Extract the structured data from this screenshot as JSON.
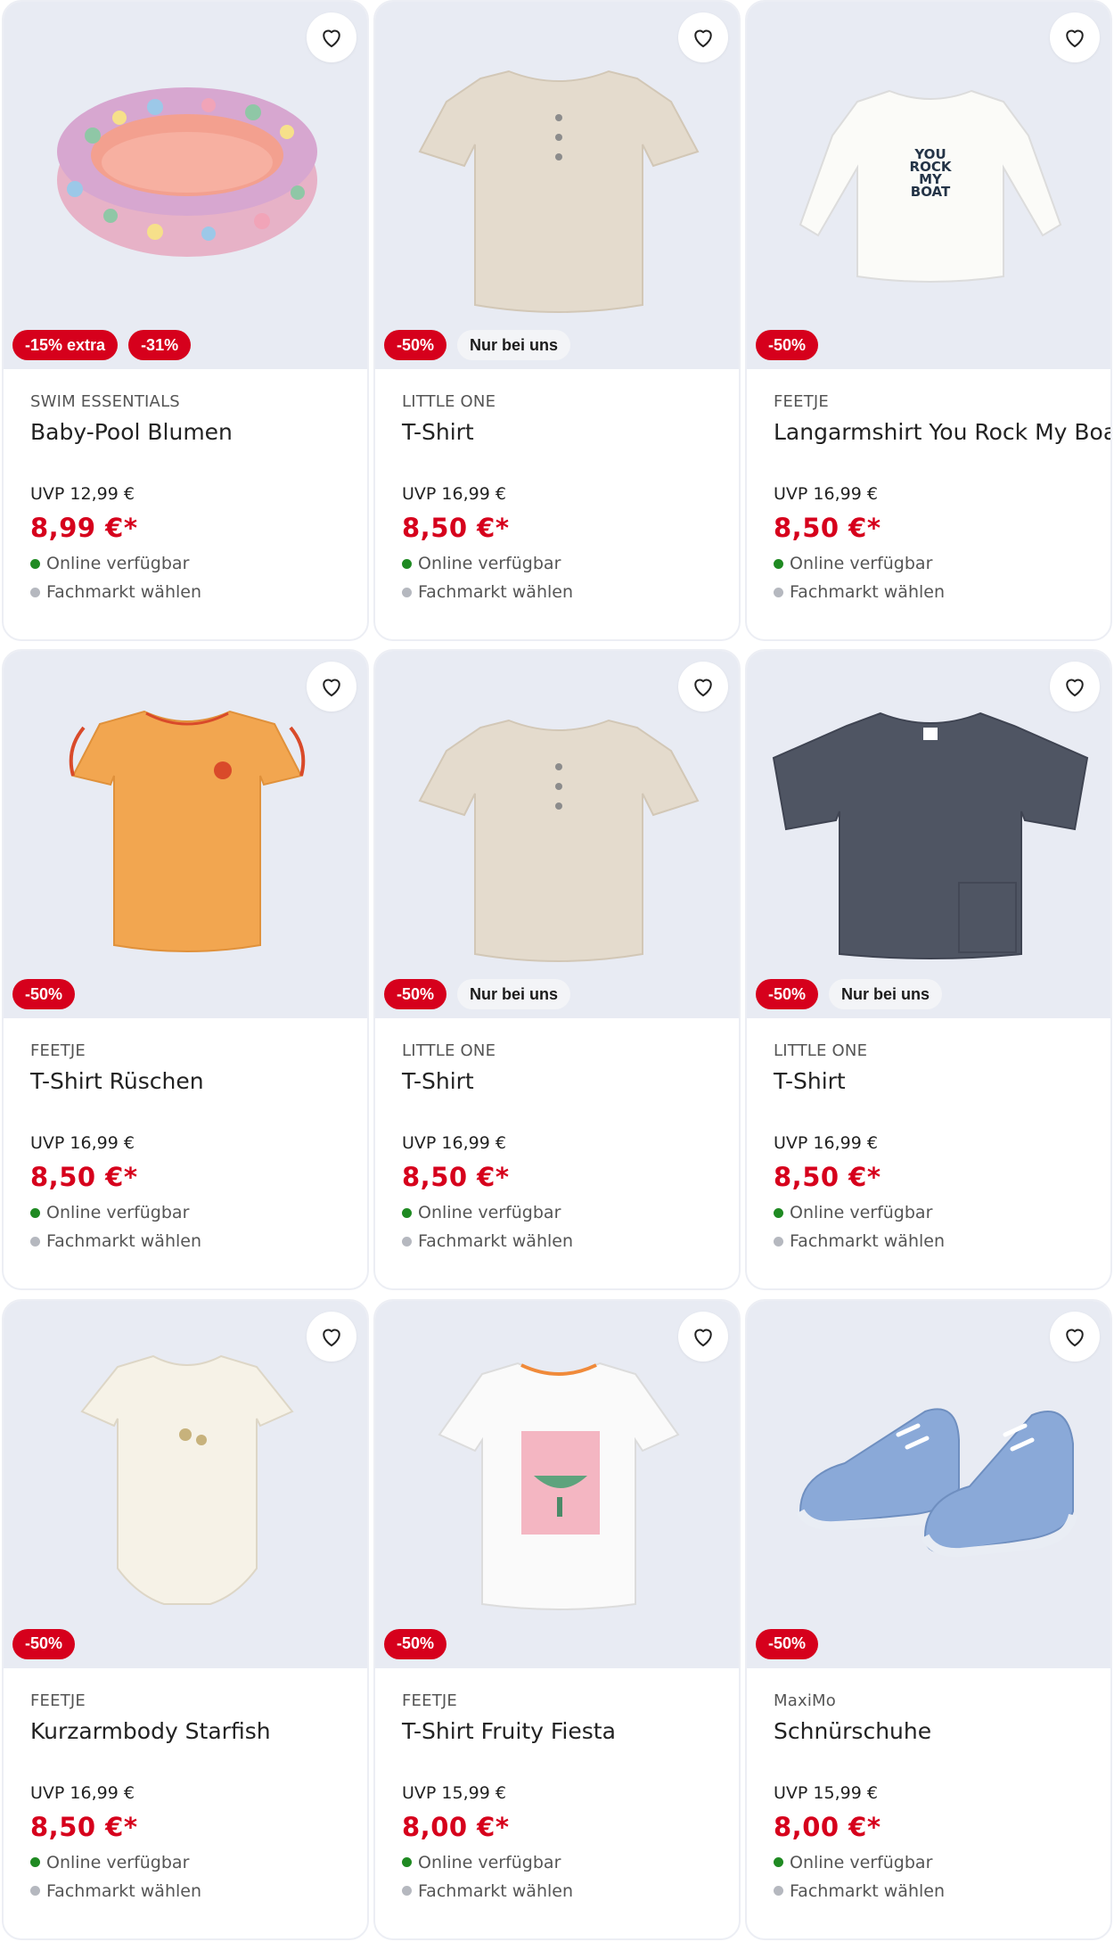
{
  "colors": {
    "sale_red": "#d6001c",
    "available_green": "#1f8a22",
    "media_bg": "#e8ebf3"
  },
  "products": [
    {
      "brand": "SWIM ESSENTIALS",
      "title": "Baby-Pool Blumen",
      "uvp": "UVP 12,99 €",
      "price": "8,99 €*",
      "badges": [
        "-15% extra",
        "-31%"
      ],
      "online": "Online verfügbar",
      "store": "Fachmarkt wählen",
      "image_icon": "pool-icon"
    },
    {
      "brand": "LITTLE ONE",
      "title": "T-Shirt",
      "uvp": "UVP 16,99 €",
      "price": "8,50 €*",
      "badges": [
        "-50%",
        "Nur bei uns"
      ],
      "online": "Online verfügbar",
      "store": "Fachmarkt wählen",
      "image_icon": "shirt-icon"
    },
    {
      "brand": "FEETJE",
      "title": "Langarmshirt You Rock My Boat",
      "uvp": "UVP 16,99 €",
      "price": "8,50 €*",
      "badges": [
        "-50%"
      ],
      "online": "Online verfügbar",
      "store": "Fachmarkt wählen",
      "image_icon": "longsleeve-icon",
      "print_text": [
        "YOU",
        "ROCK",
        "MY",
        "BOAT"
      ]
    },
    {
      "brand": "FEETJE",
      "title": "T-Shirt Rüschen",
      "uvp": "UVP 16,99 €",
      "price": "8,50 €*",
      "badges": [
        "-50%"
      ],
      "online": "Online verfügbar",
      "store": "Fachmarkt wählen",
      "image_icon": "ruffle-shirt-icon"
    },
    {
      "brand": "LITTLE ONE",
      "title": "T-Shirt",
      "uvp": "UVP 16,99 €",
      "price": "8,50 €*",
      "badges": [
        "-50%",
        "Nur bei uns"
      ],
      "online": "Online verfügbar",
      "store": "Fachmarkt wählen",
      "image_icon": "shirt-icon"
    },
    {
      "brand": "LITTLE ONE",
      "title": "T-Shirt",
      "uvp": "UVP 16,99 €",
      "price": "8,50 €*",
      "badges": [
        "-50%",
        "Nur bei uns"
      ],
      "online": "Online verfügbar",
      "store": "Fachmarkt wählen",
      "image_icon": "shirt-icon"
    },
    {
      "brand": "FEETJE",
      "title": "Kurzarmbody Starfish",
      "uvp": "UVP 16,99 €",
      "price": "8,50 €*",
      "badges": [
        "-50%"
      ],
      "online": "Online verfügbar",
      "store": "Fachmarkt wählen",
      "image_icon": "bodysuit-icon"
    },
    {
      "brand": "FEETJE",
      "title": "T-Shirt Fruity Fiesta",
      "uvp": "UVP 15,99 €",
      "price": "8,00 €*",
      "badges": [
        "-50%"
      ],
      "online": "Online verfügbar",
      "store": "Fachmarkt wählen",
      "image_icon": "print-shirt-icon"
    },
    {
      "brand": "MaxiMo",
      "title": "Schnürschuhe",
      "uvp": "UVP 15,99 €",
      "price": "8,00 €*",
      "badges": [
        "-50%"
      ],
      "online": "Online verfügbar",
      "store": "Fachmarkt wählen",
      "image_icon": "shoes-icon"
    }
  ]
}
